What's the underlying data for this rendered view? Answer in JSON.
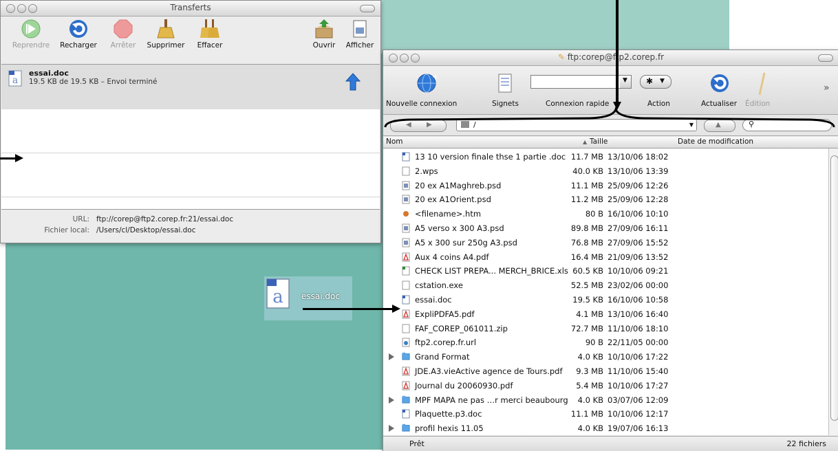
{
  "transfers": {
    "title": "Transferts",
    "toolbar": {
      "reprendre": "Reprendre",
      "recharger": "Recharger",
      "arreter": "Arrêter",
      "supprimer": "Supprimer",
      "effacer": "Effacer",
      "ouvrir": "Ouvrir",
      "afficher": "Afficher"
    },
    "item": {
      "name": "essai.doc",
      "status": "19.5 KB de 19.5 KB – Envoi terminé"
    },
    "info": {
      "url_label": "URL:",
      "url_value": "ftp://corep@ftp2.corep.fr:21/essai.doc",
      "local_label": "Fichier local:",
      "local_value": "/Users/cl/Desktop/essai.doc"
    }
  },
  "desktop": {
    "icon_label": "essai.doc"
  },
  "ftp": {
    "title": "ftp:corep@ftp2.corep.fr",
    "toolbar": {
      "nouvelle_connexion": "Nouvelle connexion",
      "signets": "Signets",
      "connexion_rapide": "Connexion rapide",
      "action": "Action",
      "actualiser": "Actualiser",
      "edition": "Édition"
    },
    "path": "/",
    "columns": {
      "name": "Nom",
      "size": "Taille",
      "date": "Date de modification"
    },
    "files": [
      {
        "name": "13 10 version finale thse 1 partie .doc",
        "size": "11.7 MB",
        "date": "13/10/06 18:02",
        "type": "doc"
      },
      {
        "name": "2.wps",
        "size": "40.0 KB",
        "date": "13/10/06 13:39",
        "type": "file"
      },
      {
        "name": "20 ex A1Maghreb.psd",
        "size": "11.1 MB",
        "date": "25/09/06 12:26",
        "type": "psd"
      },
      {
        "name": "20 ex A1Orient.psd",
        "size": "11.2 MB",
        "date": "25/09/06 12:28",
        "type": "psd"
      },
      {
        "name": "<filename>.htm",
        "size": "80 B",
        "date": "16/10/06 10:10",
        "type": "htm"
      },
      {
        "name": "A5 verso x 300 A3.psd",
        "size": "89.8 MB",
        "date": "27/09/06 16:11",
        "type": "psd"
      },
      {
        "name": "A5 x 300 sur 250g A3.psd",
        "size": "76.8 MB",
        "date": "27/09/06 15:52",
        "type": "psd"
      },
      {
        "name": "Aux 4 coins A4.pdf",
        "size": "16.4 MB",
        "date": "21/09/06 13:52",
        "type": "pdf"
      },
      {
        "name": "CHECK LIST PREPA... MERCH_BRICE.xls",
        "size": "60.5 KB",
        "date": "10/10/06 09:21",
        "type": "xls"
      },
      {
        "name": "cstation.exe",
        "size": "52.5 MB",
        "date": "23/02/06 00:00",
        "type": "file"
      },
      {
        "name": "essai.doc",
        "size": "19.5 KB",
        "date": "16/10/06 10:58",
        "type": "doc"
      },
      {
        "name": "ExpliPDFA5.pdf",
        "size": "4.1 MB",
        "date": "13/10/06 16:40",
        "type": "pdf"
      },
      {
        "name": "FAF_COREP_061011.zip",
        "size": "72.7 MB",
        "date": "11/10/06 18:10",
        "type": "file"
      },
      {
        "name": "ftp2.corep.fr.url",
        "size": "90 B",
        "date": "22/11/05 00:00",
        "type": "url"
      },
      {
        "name": "Grand Format",
        "size": "4.0 KB",
        "date": "10/10/06 17:22",
        "type": "folder"
      },
      {
        "name": "JDE.A3.vieActive agence de Tours.pdf",
        "size": "9.3 MB",
        "date": "11/10/06 15:40",
        "type": "pdf"
      },
      {
        "name": "Journal du 20060930.pdf",
        "size": "5.4 MB",
        "date": "10/10/06 17:27",
        "type": "pdf"
      },
      {
        "name": "MPF MAPA ne pas …r merci beaubourg",
        "size": "4.0 KB",
        "date": "03/07/06 12:09",
        "type": "folder"
      },
      {
        "name": "Plaquette.p3.doc",
        "size": "11.1 MB",
        "date": "10/10/06 12:17",
        "type": "doc"
      },
      {
        "name": "profil hexis 11.05",
        "size": "4.0 KB",
        "date": "19/07/06 16:13",
        "type": "folder"
      }
    ],
    "status_left": "Prêt",
    "status_right": "22 fichiers"
  },
  "colors": {
    "desktop": "#6fb7aa",
    "folder": "#5aa6e6",
    "pdf": "#d8332f",
    "arrow": "#000000"
  }
}
